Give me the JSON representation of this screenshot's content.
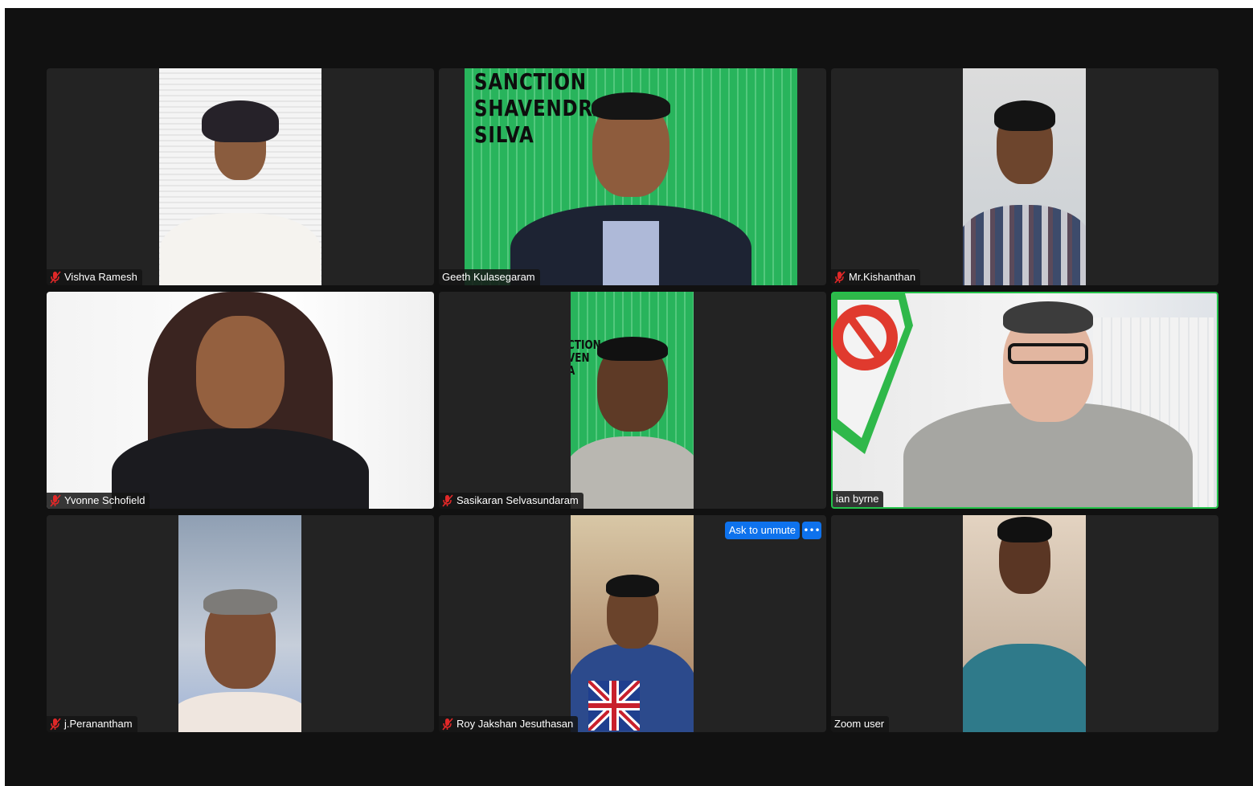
{
  "meeting": {
    "participants": [
      {
        "name": "Vishva Ramesh",
        "muted": true
      },
      {
        "name": "Geeth Kulasegaram",
        "muted": false
      },
      {
        "name": "Mr.Kishanthan",
        "muted": true
      },
      {
        "name": "Yvonne Schofield",
        "muted": true
      },
      {
        "name": "Sasikaran Selvasundaram",
        "muted": true
      },
      {
        "name": "ian byrne",
        "muted": false,
        "active_speaker": true
      },
      {
        "name": "j.Peranantham",
        "muted": true
      },
      {
        "name": "Roy Jakshan Jesuthasan",
        "muted": true
      },
      {
        "name": "Zoom user",
        "muted": false
      }
    ],
    "ask_to_unmute_label": "Ask to unmute",
    "more_options_label": "•••",
    "backdrop_banner": {
      "line1": "SANCTION",
      "line2": "SHAVENDRA",
      "line3": "SILVA"
    },
    "backdrop_banner_partial": {
      "line1": "CTION",
      "line2": "VEN",
      "line3": "A"
    }
  },
  "colors": {
    "background": "#111111",
    "tile": "#232323",
    "active_border": "#24c24a",
    "mute_icon": "#e02828",
    "button_blue": "#0e72ed",
    "backdrop_green": "#28b45c"
  }
}
